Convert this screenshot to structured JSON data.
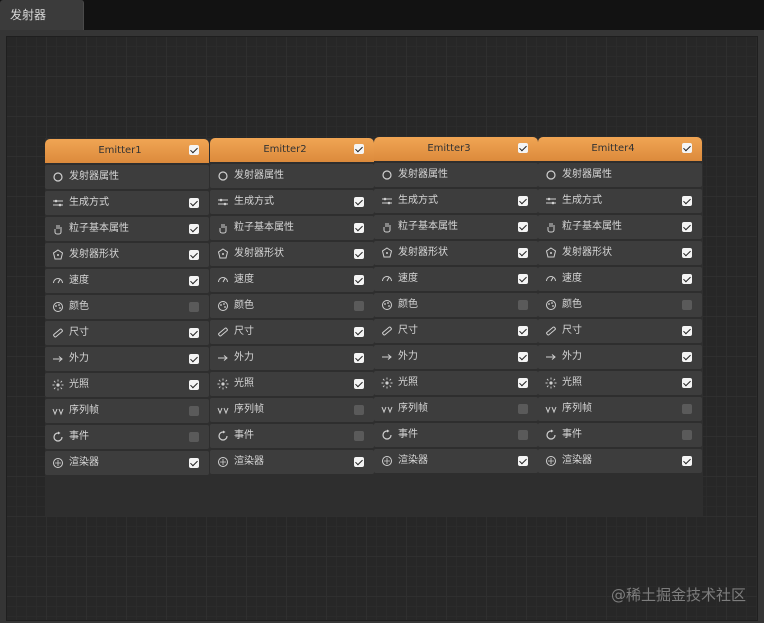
{
  "tab": {
    "title": "发射器"
  },
  "watermark": "@稀土掘金技术社区",
  "colors": {
    "header": "#e8994a",
    "row": "#3d3d3d",
    "canvas": "#272727"
  },
  "emitters": [
    {
      "name": "Emitter1",
      "enabled": true,
      "rows": [
        {
          "label": "发射器属性",
          "icon": "circle-icon",
          "checkbox": null
        },
        {
          "label": "生成方式",
          "icon": "sliders-icon",
          "checkbox": true
        },
        {
          "label": "粒子基本属性",
          "icon": "hand-icon",
          "checkbox": true
        },
        {
          "label": "发射器形状",
          "icon": "shape-icon",
          "checkbox": true
        },
        {
          "label": "速度",
          "icon": "speedometer-icon",
          "checkbox": true
        },
        {
          "label": "颜色",
          "icon": "palette-icon",
          "checkbox": false
        },
        {
          "label": "尺寸",
          "icon": "ruler-icon",
          "checkbox": true
        },
        {
          "label": "外力",
          "icon": "arrow-force-icon",
          "checkbox": true
        },
        {
          "label": "光照",
          "icon": "light-icon",
          "checkbox": true
        },
        {
          "label": "序列帧",
          "icon": "sequence-icon",
          "checkbox": false
        },
        {
          "label": "事件",
          "icon": "event-icon",
          "checkbox": false
        },
        {
          "label": "渲染器",
          "icon": "renderer-icon",
          "checkbox": true
        }
      ]
    },
    {
      "name": "Emitter2",
      "enabled": true,
      "rows": [
        {
          "label": "发射器属性",
          "icon": "circle-icon",
          "checkbox": null
        },
        {
          "label": "生成方式",
          "icon": "sliders-icon",
          "checkbox": true
        },
        {
          "label": "粒子基本属性",
          "icon": "hand-icon",
          "checkbox": true
        },
        {
          "label": "发射器形状",
          "icon": "shape-icon",
          "checkbox": true
        },
        {
          "label": "速度",
          "icon": "speedometer-icon",
          "checkbox": true
        },
        {
          "label": "颜色",
          "icon": "palette-icon",
          "checkbox": false
        },
        {
          "label": "尺寸",
          "icon": "ruler-icon",
          "checkbox": true
        },
        {
          "label": "外力",
          "icon": "arrow-force-icon",
          "checkbox": true
        },
        {
          "label": "光照",
          "icon": "light-icon",
          "checkbox": true
        },
        {
          "label": "序列帧",
          "icon": "sequence-icon",
          "checkbox": false
        },
        {
          "label": "事件",
          "icon": "event-icon",
          "checkbox": false
        },
        {
          "label": "渲染器",
          "icon": "renderer-icon",
          "checkbox": true
        }
      ]
    },
    {
      "name": "Emitter3",
      "enabled": true,
      "rows": [
        {
          "label": "发射器属性",
          "icon": "circle-icon",
          "checkbox": null
        },
        {
          "label": "生成方式",
          "icon": "sliders-icon",
          "checkbox": true
        },
        {
          "label": "粒子基本属性",
          "icon": "hand-icon",
          "checkbox": true
        },
        {
          "label": "发射器形状",
          "icon": "shape-icon",
          "checkbox": true
        },
        {
          "label": "速度",
          "icon": "speedometer-icon",
          "checkbox": true
        },
        {
          "label": "颜色",
          "icon": "palette-icon",
          "checkbox": false
        },
        {
          "label": "尺寸",
          "icon": "ruler-icon",
          "checkbox": true
        },
        {
          "label": "外力",
          "icon": "arrow-force-icon",
          "checkbox": true
        },
        {
          "label": "光照",
          "icon": "light-icon",
          "checkbox": true
        },
        {
          "label": "序列帧",
          "icon": "sequence-icon",
          "checkbox": false
        },
        {
          "label": "事件",
          "icon": "event-icon",
          "checkbox": false
        },
        {
          "label": "渲染器",
          "icon": "renderer-icon",
          "checkbox": true
        }
      ]
    },
    {
      "name": "Emitter4",
      "enabled": true,
      "rows": [
        {
          "label": "发射器属性",
          "icon": "circle-icon",
          "checkbox": null
        },
        {
          "label": "生成方式",
          "icon": "sliders-icon",
          "checkbox": true
        },
        {
          "label": "粒子基本属性",
          "icon": "hand-icon",
          "checkbox": true
        },
        {
          "label": "发射器形状",
          "icon": "shape-icon",
          "checkbox": true
        },
        {
          "label": "速度",
          "icon": "speedometer-icon",
          "checkbox": true
        },
        {
          "label": "颜色",
          "icon": "palette-icon",
          "checkbox": false
        },
        {
          "label": "尺寸",
          "icon": "ruler-icon",
          "checkbox": true
        },
        {
          "label": "外力",
          "icon": "arrow-force-icon",
          "checkbox": true
        },
        {
          "label": "光照",
          "icon": "light-icon",
          "checkbox": true
        },
        {
          "label": "序列帧",
          "icon": "sequence-icon",
          "checkbox": false
        },
        {
          "label": "事件",
          "icon": "event-icon",
          "checkbox": false
        },
        {
          "label": "渲染器",
          "icon": "renderer-icon",
          "checkbox": true
        }
      ]
    }
  ]
}
